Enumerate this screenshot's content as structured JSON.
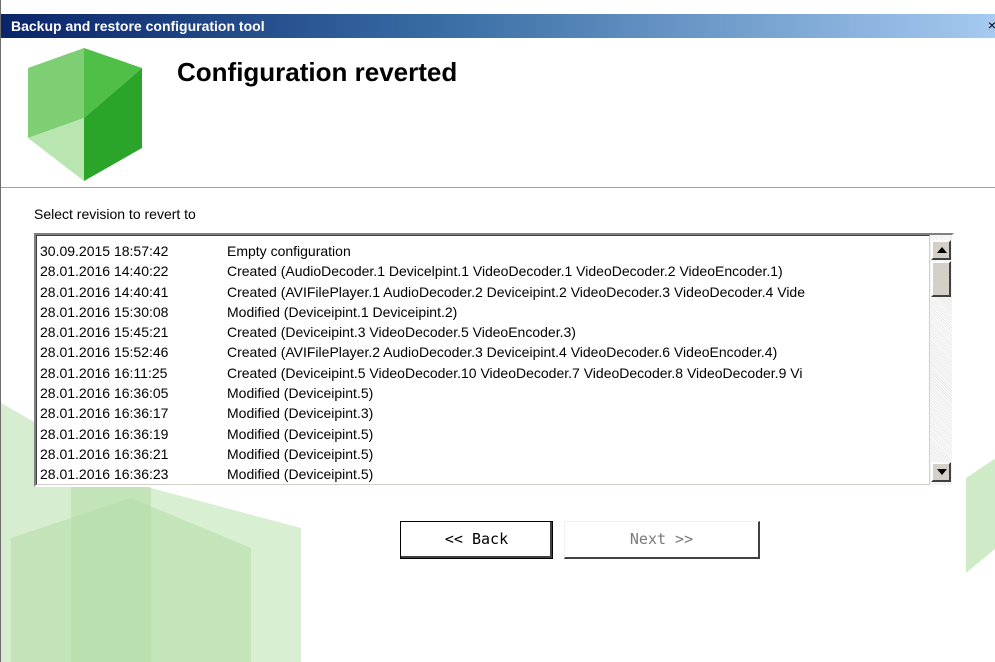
{
  "window": {
    "title": "Backup and restore configuration tool",
    "close_glyph": "×"
  },
  "header": {
    "title": "Configuration reverted",
    "logo_icon": "green-cube-logo-icon"
  },
  "main": {
    "select_label": "Select revision to revert to",
    "revisions": [
      {
        "timestamp": "30.09.2015 18:57:42",
        "description": "Empty configuration"
      },
      {
        "timestamp": "28.01.2016 14:40:22",
        "description": "Created (AudioDecoder.1 Devicelpint.1 VideoDecoder.1 VideoDecoder.2 VideoEncoder.1)"
      },
      {
        "timestamp": "28.01.2016 14:40:41",
        "description": "Created (AVIFilePlayer.1 AudioDecoder.2 Deviceipint.2 VideoDecoder.3 VideoDecoder.4 Vide"
      },
      {
        "timestamp": "28.01.2016 15:30:08",
        "description": "Modified (Deviceipint.1 Deviceipint.2)"
      },
      {
        "timestamp": "28.01.2016 15:45:21",
        "description": "Created (Deviceipint.3 VideoDecoder.5 VideoEncoder.3)"
      },
      {
        "timestamp": "28.01.2016 15:52:46",
        "description": "Created (AVIFilePlayer.2 AudioDecoder.3 Deviceipint.4 VideoDecoder.6 VideoEncoder.4)"
      },
      {
        "timestamp": "28.01.2016 16:11:25",
        "description": "Created (Deviceipint.5 VideoDecoder.10 VideoDecoder.7 VideoDecoder.8 VideoDecoder.9 Vi"
      },
      {
        "timestamp": "28.01.2016 16:36:05",
        "description": "Modified (Deviceipint.5)"
      },
      {
        "timestamp": "28.01.2016 16:36:17",
        "description": "Modified (Deviceipint.3)"
      },
      {
        "timestamp": "28.01.2016 16:36:19",
        "description": "Modified (Deviceipint.5)"
      },
      {
        "timestamp": "28.01.2016 16:36:21",
        "description": "Modified (Deviceipint.5)"
      },
      {
        "timestamp": "28.01.2016 16:36:23",
        "description": "Modified (Deviceipint.5)"
      }
    ],
    "scrollbar": {
      "up_icon": "scroll-up-arrow-icon",
      "down_icon": "scroll-down-arrow-icon"
    }
  },
  "buttons": {
    "back_label": "<< Back",
    "next_label": "Next >>",
    "next_enabled": false
  },
  "colors": {
    "titlebar_start": "#0a246a",
    "titlebar_end": "#a6caf0",
    "logo_green": "#2eaa2e",
    "background_green": "#c8e6c0",
    "disabled_text": "#7a7a7a"
  }
}
